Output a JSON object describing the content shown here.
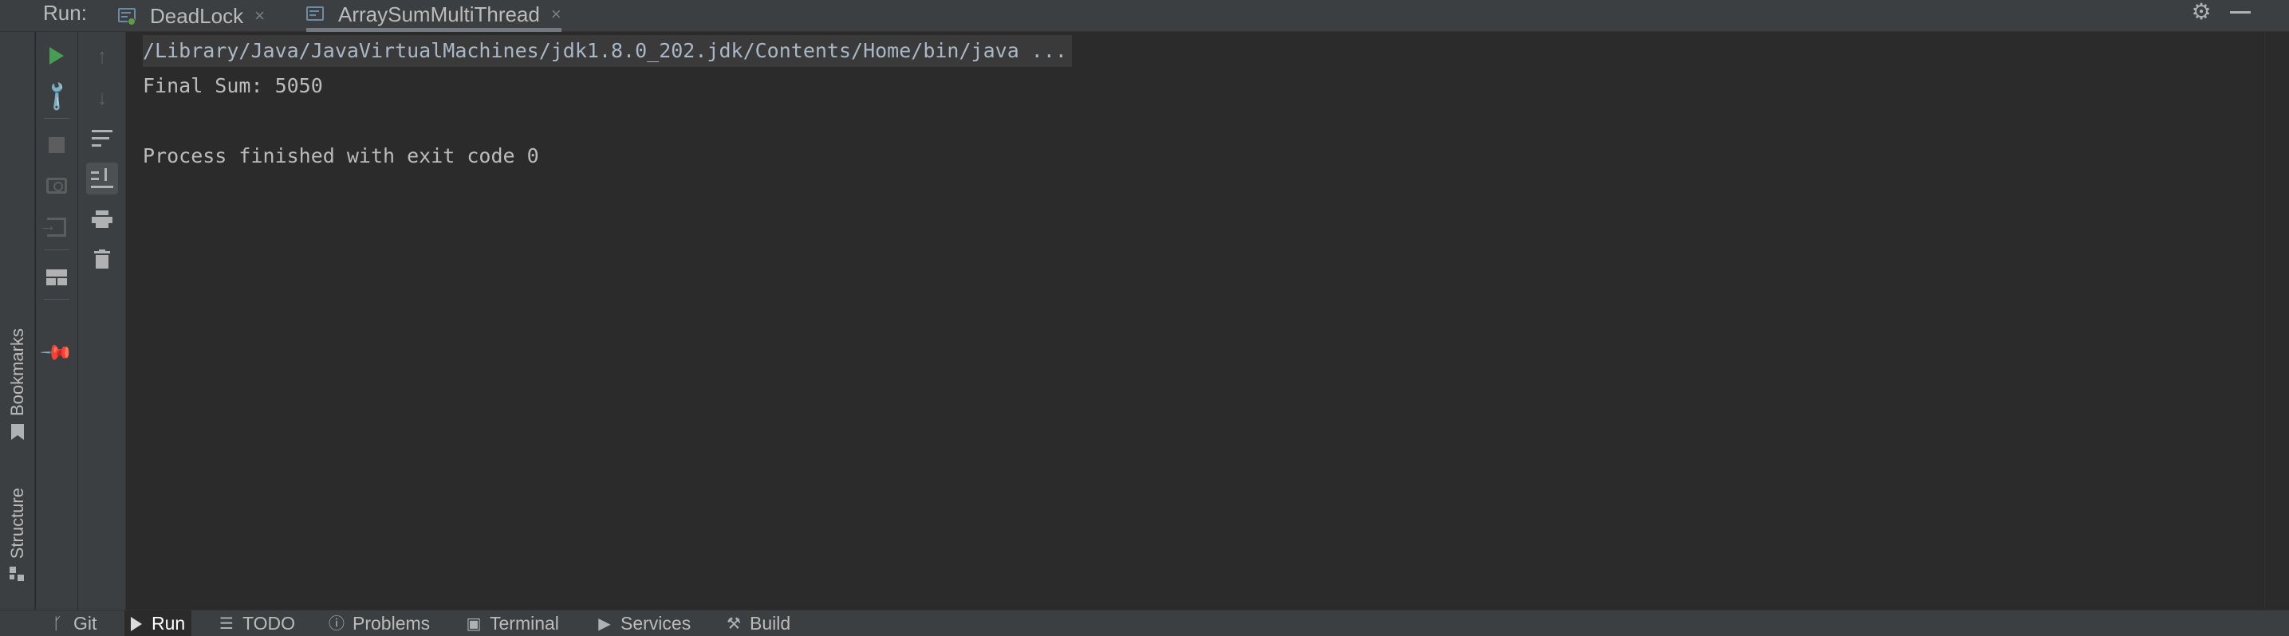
{
  "run_bar": {
    "label": "Run:",
    "tabs": [
      {
        "label": "DeadLock",
        "close": "×",
        "selected": false
      },
      {
        "label": "ArraySumMultiThread",
        "close": "×",
        "selected": true
      }
    ],
    "settings_icon": "gear-icon",
    "hide_icon": "minimize-icon"
  },
  "left_strip": {
    "bookmarks_label": "Bookmarks",
    "structure_label": "Structure"
  },
  "toolbar_left": {
    "icons": [
      "rerun-icon",
      "modify-run-config-icon",
      "stop-icon",
      "dump-threads-icon",
      "restore-layout-icon",
      "layout-icon",
      "pin-tab-icon"
    ]
  },
  "toolbar_right": {
    "icons": [
      "up-stack-trace-icon",
      "down-stack-trace-icon",
      "soft-wrap-icon",
      "scroll-to-end-icon",
      "print-icon",
      "clear-all-icon"
    ]
  },
  "console": {
    "command_line": "/Library/Java/JavaVirtualMachines/jdk1.8.0_202.jdk/Contents/Home/bin/java ...",
    "output_line": "Final Sum: 5050",
    "exit_line": "Process finished with exit code 0"
  },
  "bottom_bar": {
    "tabs": [
      {
        "label": "Git",
        "icon": "git-branch-icon"
      },
      {
        "label": "Run",
        "icon": "run-icon",
        "selected": true
      },
      {
        "label": "TODO",
        "icon": "todo-list-icon"
      },
      {
        "label": "Problems",
        "icon": "problems-icon"
      },
      {
        "label": "Terminal",
        "icon": "terminal-icon"
      },
      {
        "label": "Services",
        "icon": "services-icon"
      },
      {
        "label": "Build",
        "icon": "hammer-icon"
      }
    ]
  },
  "colors": {
    "panel": "#3c3f41",
    "editor": "#2b2b2b",
    "text": "#bbbbbb",
    "run_green": "#499c54"
  }
}
